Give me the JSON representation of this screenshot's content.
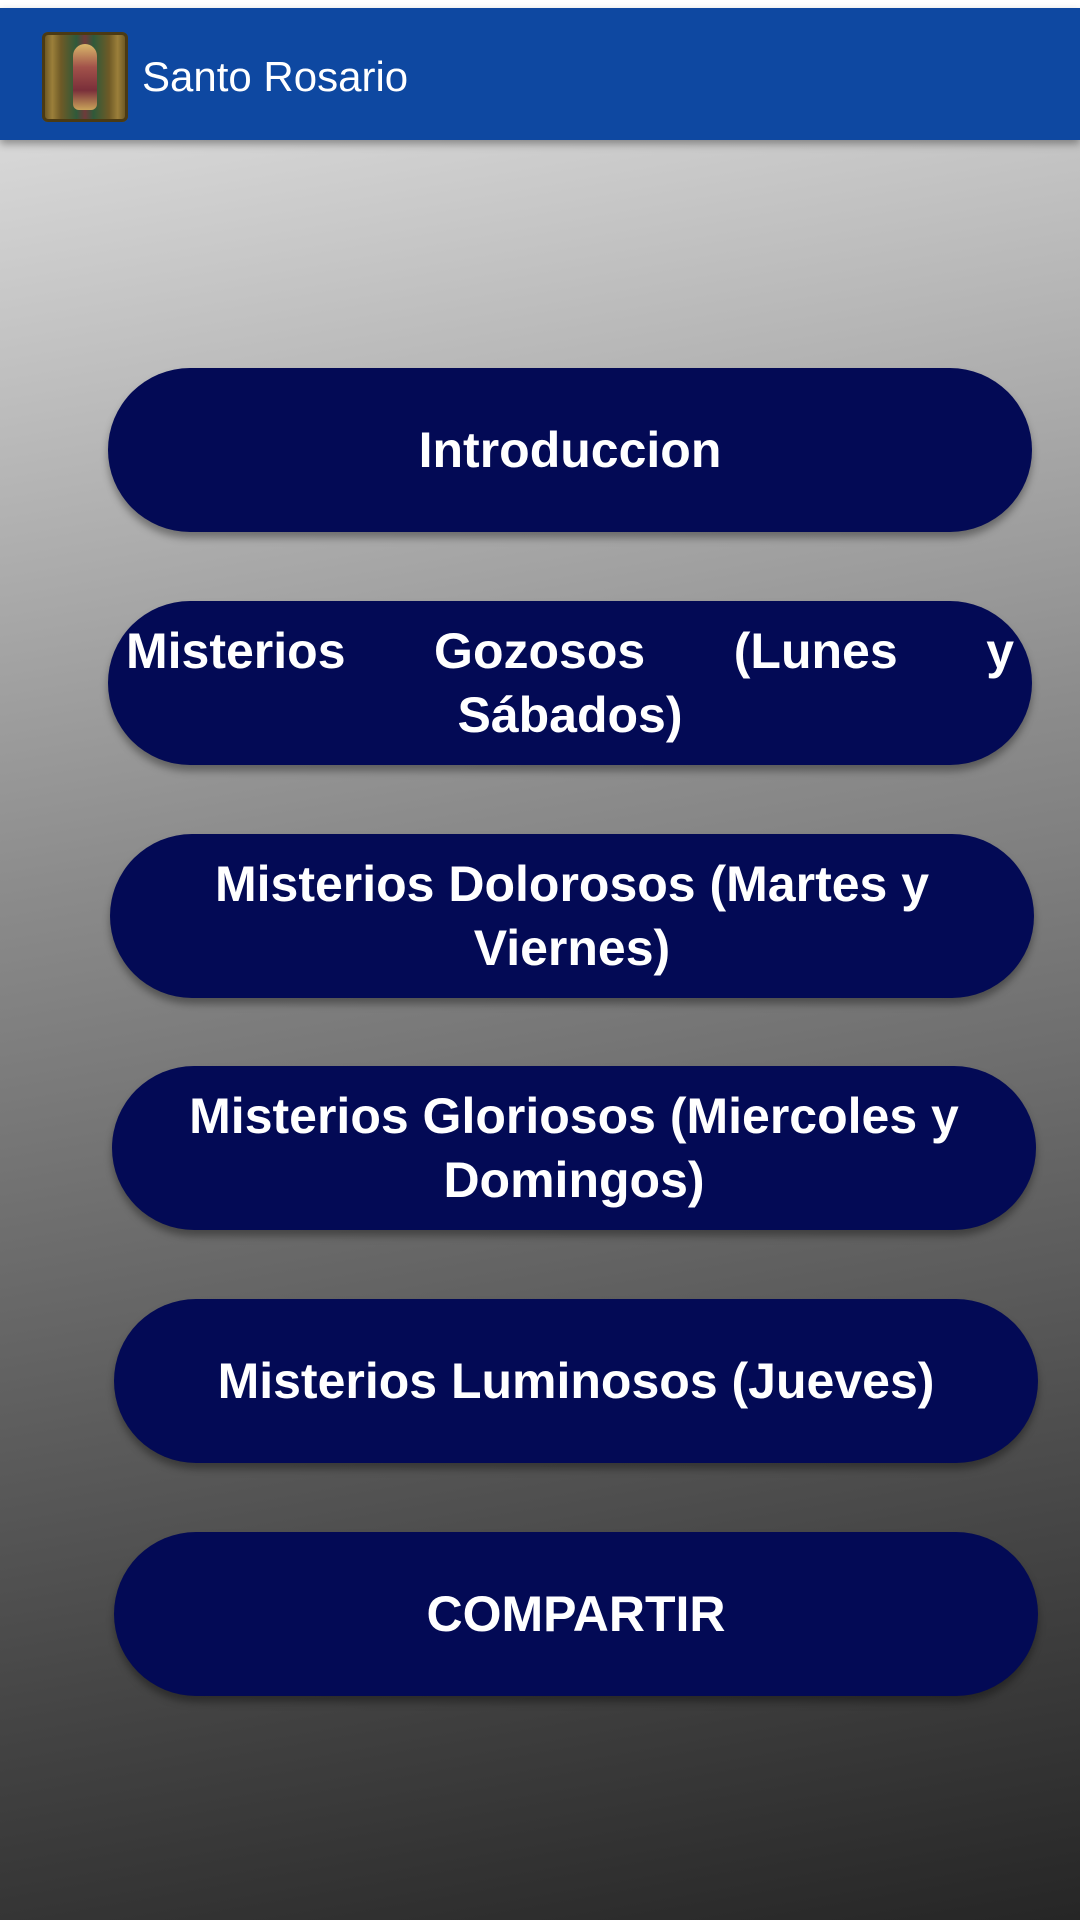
{
  "app_bar": {
    "title": "Santo Rosario",
    "icon": "virgin-of-guadalupe-icon"
  },
  "menu": {
    "buttons": [
      {
        "label": "Introduccion"
      },
      {
        "label": "Misterios Gozosos (Lunes y Sábados)"
      },
      {
        "label": "Misterios Dolorosos (Martes y Viernes)"
      },
      {
        "label": "Misterios Gloriosos (Miercoles y Domingos)"
      },
      {
        "label": "Misterios Luminosos (Jueves)"
      },
      {
        "label": "COMPARTIR"
      }
    ]
  },
  "colors": {
    "app_bar": "#0e48a1",
    "button": "#030a55",
    "button_text": "#ffffff"
  }
}
